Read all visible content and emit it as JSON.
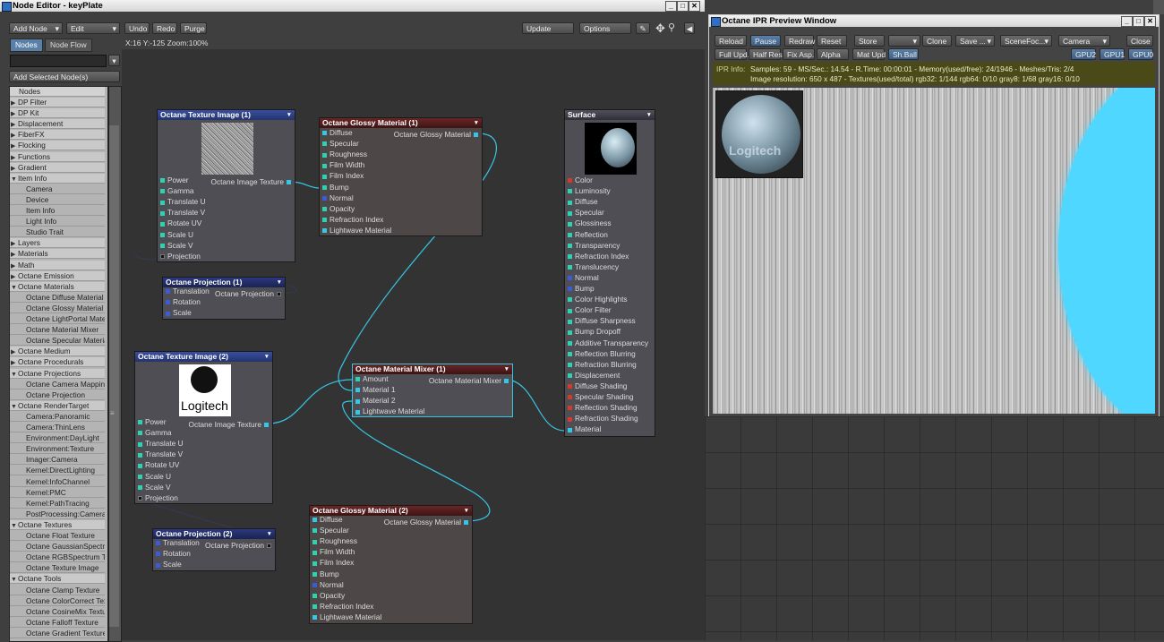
{
  "node_editor": {
    "title": "Node Editor - keyPlate",
    "toolbar": {
      "add_node": "Add Node",
      "edit": "Edit",
      "undo": "Undo",
      "redo": "Redo",
      "purge": "Purge",
      "update": "Update",
      "options": "Options"
    },
    "tabs": [
      "Nodes",
      "Node Flow"
    ],
    "add_selected": "Add Selected Node(s)",
    "coords": "X:16 Y:-125 Zoom:100%",
    "list_header": "Nodes",
    "list": [
      {
        "label": "DP Filter",
        "type": "cat",
        "arrow": "▶"
      },
      {
        "label": "DP Kit",
        "type": "cat",
        "arrow": "▶"
      },
      {
        "label": "Displacement",
        "type": "cat",
        "arrow": "▶"
      },
      {
        "label": "FiberFX",
        "type": "cat",
        "arrow": "▶"
      },
      {
        "label": "Flocking",
        "type": "cat",
        "arrow": "▶"
      },
      {
        "label": "Functions",
        "type": "cat",
        "arrow": "▶"
      },
      {
        "label": "Gradient",
        "type": "cat",
        "arrow": "▶"
      },
      {
        "label": "Item Info",
        "type": "cat",
        "arrow": "▼"
      },
      {
        "label": "Camera",
        "type": "sub"
      },
      {
        "label": "Device",
        "type": "sub"
      },
      {
        "label": "Item Info",
        "type": "sub"
      },
      {
        "label": "Light Info",
        "type": "sub"
      },
      {
        "label": "Studio Trait",
        "type": "sub"
      },
      {
        "label": "Layers",
        "type": "cat",
        "arrow": "▶"
      },
      {
        "label": "Materials",
        "type": "cat",
        "arrow": "▶"
      },
      {
        "label": "Math",
        "type": "cat",
        "arrow": "▶"
      },
      {
        "label": "Octane Emission",
        "type": "cat",
        "arrow": "▶"
      },
      {
        "label": "Octane Materials",
        "type": "cat",
        "arrow": "▼"
      },
      {
        "label": "Octane Diffuse Material",
        "type": "sub"
      },
      {
        "label": "Octane Glossy Material",
        "type": "sub"
      },
      {
        "label": "Octane LightPortal Material",
        "type": "sub"
      },
      {
        "label": "Octane Material Mixer",
        "type": "sub"
      },
      {
        "label": "Octane Specular Material",
        "type": "sub"
      },
      {
        "label": "Octane Medium",
        "type": "cat",
        "arrow": "▶"
      },
      {
        "label": "Octane Procedurals",
        "type": "cat",
        "arrow": "▶"
      },
      {
        "label": "Octane Projections",
        "type": "cat",
        "arrow": "▼"
      },
      {
        "label": "Octane Camera Mapping",
        "type": "sub"
      },
      {
        "label": "Octane Projection",
        "type": "sub"
      },
      {
        "label": "Octane RenderTarget",
        "type": "cat",
        "arrow": "▼"
      },
      {
        "label": "Camera:Panoramic",
        "type": "sub"
      },
      {
        "label": "Camera:ThinLens",
        "type": "sub"
      },
      {
        "label": "Environment:DayLight",
        "type": "sub"
      },
      {
        "label": "Environment:Texture",
        "type": "sub"
      },
      {
        "label": "Imager:Camera",
        "type": "sub"
      },
      {
        "label": "Kernel:DirectLighting",
        "type": "sub"
      },
      {
        "label": "Kernel:InfoChannel",
        "type": "sub"
      },
      {
        "label": "Kernel:PMC",
        "type": "sub"
      },
      {
        "label": "Kernel:PathTracing",
        "type": "sub"
      },
      {
        "label": "PostProcessing:Camera",
        "type": "sub"
      },
      {
        "label": "Octane Textures",
        "type": "cat",
        "arrow": "▼"
      },
      {
        "label": "Octane Float Texture",
        "type": "sub"
      },
      {
        "label": "Octane GaussianSpectrum",
        "type": "sub"
      },
      {
        "label": "Octane RGBSpectrum Texture",
        "type": "sub"
      },
      {
        "label": "Octane Texture Image",
        "type": "sub"
      },
      {
        "label": "Octane Tools",
        "type": "cat",
        "arrow": "▼"
      },
      {
        "label": "Octane Clamp Texture",
        "type": "sub"
      },
      {
        "label": "Octane ColorCorrect Texture",
        "type": "sub"
      },
      {
        "label": "Octane CosineMix Texture",
        "type": "sub"
      },
      {
        "label": "Octane Falloff Texture",
        "type": "sub"
      },
      {
        "label": "Octane Gradient Texture",
        "type": "sub"
      }
    ],
    "nodes": {
      "tex1": {
        "title": "Octane Texture Image (1)",
        "output": "Octane Image Texture",
        "inputs": [
          "Power",
          "Gamma",
          "Translate U",
          "Translate V",
          "Rotate UV",
          "Scale U",
          "Scale V",
          "Projection"
        ]
      },
      "gloss1": {
        "title": "Octane Glossy Material (1)",
        "output": "Octane Glossy Material",
        "inputs": [
          "Diffuse",
          "Specular",
          "Roughness",
          "Film Width",
          "Film Index",
          "Bump",
          "Normal",
          "Opacity",
          "Refraction Index",
          "Lightwave Material"
        ]
      },
      "proj1": {
        "title": "Octane Projection (1)",
        "output": "Octane Projection",
        "inputs": [
          "Translation",
          "Rotation",
          "Scale"
        ]
      },
      "tex2": {
        "title": "Octane Texture Image (2)",
        "output": "Octane Image Texture",
        "logo_text": "Logitech",
        "inputs": [
          "Power",
          "Gamma",
          "Translate U",
          "Translate V",
          "Rotate UV",
          "Scale U",
          "Scale V",
          "Projection"
        ]
      },
      "mixer": {
        "title": "Octane Material Mixer (1)",
        "output": "Octane Material Mixer",
        "inputs": [
          "Amount",
          "Material 1",
          "Material 2",
          "Lightwave Material"
        ]
      },
      "gloss2": {
        "title": "Octane Glossy Material (2)",
        "output": "Octane Glossy Material",
        "inputs": [
          "Diffuse",
          "Specular",
          "Roughness",
          "Film Width",
          "Film Index",
          "Bump",
          "Normal",
          "Opacity",
          "Refraction Index",
          "Lightwave Material"
        ]
      },
      "proj2": {
        "title": "Octane Projection (2)",
        "output": "Octane Projection",
        "inputs": [
          "Translation",
          "Rotation",
          "Scale"
        ]
      },
      "surface": {
        "title": "Surface",
        "inputs": [
          "Color",
          "Luminosity",
          "Diffuse",
          "Specular",
          "Glossiness",
          "Reflection",
          "Transparency",
          "Refraction Index",
          "Translucency",
          "Normal",
          "Bump",
          "Color Highlights",
          "Color Filter",
          "Diffuse Sharpness",
          "Bump Dropoff",
          "Additive Transparency",
          "Reflection Blurring",
          "Refraction Blurring",
          "Displacement",
          "Diffuse Shading",
          "Specular Shading",
          "Reflection Shading",
          "Refraction Shading",
          "Material"
        ]
      }
    }
  },
  "ipr": {
    "title": "Octane IPR Preview Window",
    "row1": [
      "Reload",
      "Pause",
      "Redraw",
      "Reset",
      "Store",
      "",
      "Clone",
      "Save ...",
      "SceneFoc...",
      "Camera",
      "Close"
    ],
    "row2": [
      "Full Upd.",
      "Half Res",
      "Fix Asp.",
      "Alpha",
      "Mat Upd",
      "Sh.Ball"
    ],
    "gpus": [
      "GPU2",
      "GPU1",
      "GPU0"
    ],
    "info_label": "IPR Info:",
    "info_line1": "Samples: 59  -  MS/Sec.: 14.54  -  R.Time: 00:00:01  - Memory(used/free): 24/1946  -  Meshes/Tris: 2/4",
    "info_line2": "Image resolution: 650 x 487 - Textures(used/total) rgb32: 1/144   rgb64: 0/10   gray8: 1/68   gray16: 0/10",
    "thumb_text": "Logitech"
  },
  "colors": {
    "wire": "#35c8e6",
    "ipr_bg": "#dcdcdc",
    "blob": "#4fd7ff"
  }
}
